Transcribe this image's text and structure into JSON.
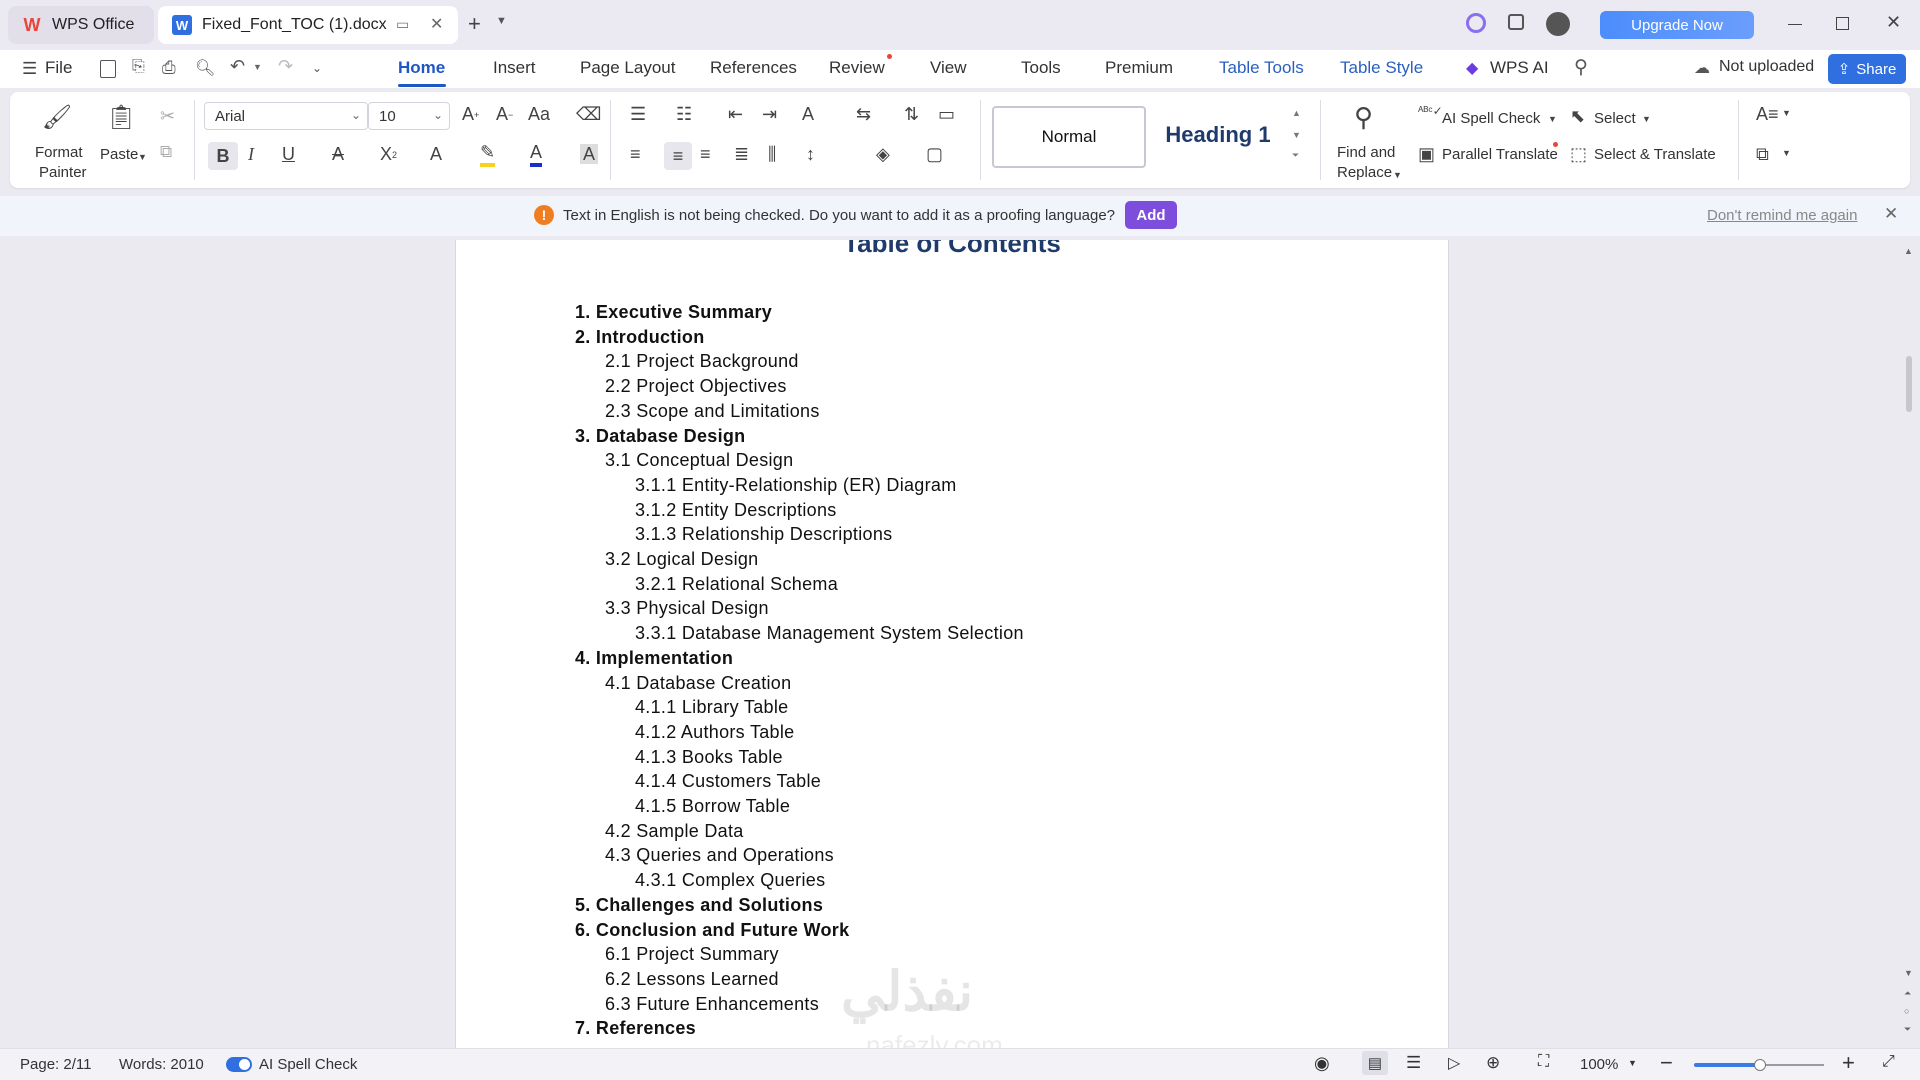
{
  "titlebar": {
    "tabs": [
      {
        "label": "WPS Office"
      },
      {
        "label": "Fixed_Font_TOC (1).docx"
      }
    ],
    "upgrade_label": "Upgrade Now"
  },
  "menu": {
    "file": "File",
    "items": [
      "Home",
      "Insert",
      "Page Layout",
      "References",
      "Review",
      "View",
      "Tools",
      "Premium",
      "Table Tools",
      "Table Style",
      "WPS AI"
    ],
    "not_uploaded": "Not uploaded",
    "share": "Share"
  },
  "ribbon": {
    "format_painter": "Format\nPainter",
    "format_painter_l1": "Format",
    "format_painter_l2": "Painter",
    "paste": "Paste",
    "font_name": "Arial",
    "font_size": "10",
    "style_normal": "Normal",
    "style_heading1": "Heading 1",
    "find_l1": "Find and",
    "find_l2": "Replace",
    "ai_spell": "AI Spell Check",
    "parallel": "Parallel Translate",
    "select": "Select",
    "select_translate": "Select & Translate"
  },
  "notification": {
    "text": "Text in English is not being checked. Do you want to add it as a proofing language?",
    "add": "Add",
    "dont_remind": "Don't remind me again"
  },
  "document": {
    "title": "Table of Contents",
    "toc": [
      {
        "text": "1. Executive Summary",
        "level": 1
      },
      {
        "text": "2. Introduction",
        "level": 1
      },
      {
        "text": "2.1 Project Background",
        "level": 2
      },
      {
        "text": "2.2 Project Objectives",
        "level": 2
      },
      {
        "text": "2.3 Scope and Limitations",
        "level": 2
      },
      {
        "text": "3. Database Design",
        "level": 1
      },
      {
        "text": "3.1 Conceptual Design",
        "level": 2
      },
      {
        "text": "3.1.1 Entity-Relationship (ER) Diagram",
        "level": 3
      },
      {
        "text": "3.1.2 Entity Descriptions",
        "level": 3
      },
      {
        "text": "3.1.3 Relationship Descriptions",
        "level": 3
      },
      {
        "text": "3.2 Logical Design",
        "level": 2
      },
      {
        "text": "3.2.1 Relational Schema",
        "level": 3
      },
      {
        "text": "3.3 Physical Design",
        "level": 2
      },
      {
        "text": "3.3.1 Database Management System Selection",
        "level": 3
      },
      {
        "text": "4. Implementation",
        "level": 1
      },
      {
        "text": "4.1 Database Creation",
        "level": 2
      },
      {
        "text": "4.1.1 Library Table",
        "level": 3
      },
      {
        "text": "4.1.2 Authors Table",
        "level": 3
      },
      {
        "text": "4.1.3 Books Table",
        "level": 3
      },
      {
        "text": "4.1.4 Customers Table",
        "level": 3
      },
      {
        "text": "4.1.5 Borrow Table",
        "level": 3
      },
      {
        "text": "4.2 Sample Data",
        "level": 2
      },
      {
        "text": "4.3 Queries and Operations",
        "level": 2
      },
      {
        "text": "4.3.1 Complex Queries",
        "level": 3
      },
      {
        "text": "5. Challenges and Solutions",
        "level": 1
      },
      {
        "text": "6. Conclusion and Future Work",
        "level": 1
      },
      {
        "text": "6.1 Project Summary",
        "level": 2
      },
      {
        "text": "6.2 Lessons Learned",
        "level": 2
      },
      {
        "text": "6.3 Future Enhancements",
        "level": 2
      },
      {
        "text": "7. References",
        "level": 1
      }
    ],
    "watermark": "نفذلي",
    "watermark_sub": "nafezly.com"
  },
  "status": {
    "page": "Page: 2/11",
    "words": "Words: 2010",
    "spell": "AI Spell Check",
    "zoom": "100%",
    "zoom_level": 0.5
  },
  "colors": {
    "accent": "#1f57c3",
    "share": "#2f6fe0",
    "add_button": "#7d4ddb",
    "toc_title": "#1f3b6b"
  }
}
